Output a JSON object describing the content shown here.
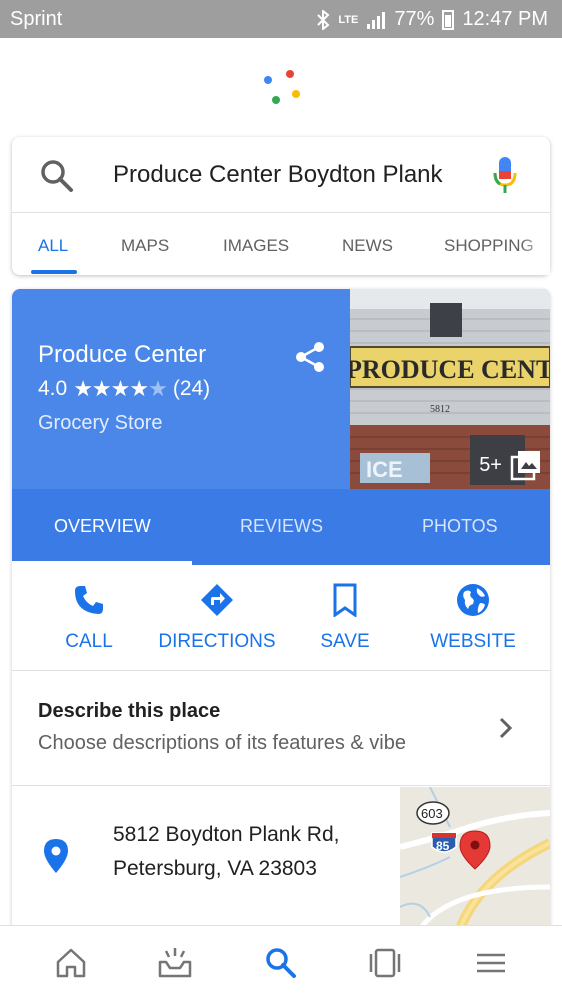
{
  "status_bar": {
    "carrier": "Sprint",
    "network": "LTE",
    "battery": "77%",
    "time": "12:47 PM"
  },
  "search": {
    "query": "Produce Center Boydton Plank",
    "tabs": [
      {
        "label": "ALL",
        "active": true
      },
      {
        "label": "MAPS",
        "active": false
      },
      {
        "label": "IMAGES",
        "active": false
      },
      {
        "label": "NEWS",
        "active": false
      },
      {
        "label": "SHOPPING",
        "active": false
      }
    ]
  },
  "place": {
    "name": "Produce Center",
    "rating": "4.0",
    "rating_value": 4.0,
    "rating_max": 5,
    "review_count": "(24)",
    "category": "Grocery Store",
    "photo": {
      "sign_text": "PRODUCE CENTER",
      "number": "5812",
      "lower_sign": "ICE",
      "count_badge": "5+"
    },
    "tabs": [
      {
        "label": "OVERVIEW",
        "active": true
      },
      {
        "label": "REVIEWS",
        "active": false
      },
      {
        "label": "PHOTOS",
        "active": false
      }
    ],
    "actions": [
      {
        "label": "CALL",
        "icon": "phone-icon"
      },
      {
        "label": "DIRECTIONS",
        "icon": "directions-icon"
      },
      {
        "label": "SAVE",
        "icon": "bookmark-icon"
      },
      {
        "label": "WEBSITE",
        "icon": "globe-icon"
      }
    ],
    "describe": {
      "title": "Describe this place",
      "subtitle": "Choose descriptions of its features & vibe"
    },
    "address": {
      "line1": "5812 Boydton Plank Rd,",
      "line2": "Petersburg, VA 23803"
    },
    "map": {
      "route_shield": "603",
      "interstate": "85"
    }
  },
  "bottom_nav": [
    {
      "icon": "home-icon"
    },
    {
      "icon": "updates-icon"
    },
    {
      "icon": "search-icon",
      "active": true
    },
    {
      "icon": "recent-apps-icon"
    },
    {
      "icon": "menu-icon"
    }
  ],
  "colors": {
    "accent": "#1a73e8",
    "hero_blue": "#4a87e8",
    "tabs_blue": "#3b7be6",
    "status_bar": "#9e9e9e"
  }
}
